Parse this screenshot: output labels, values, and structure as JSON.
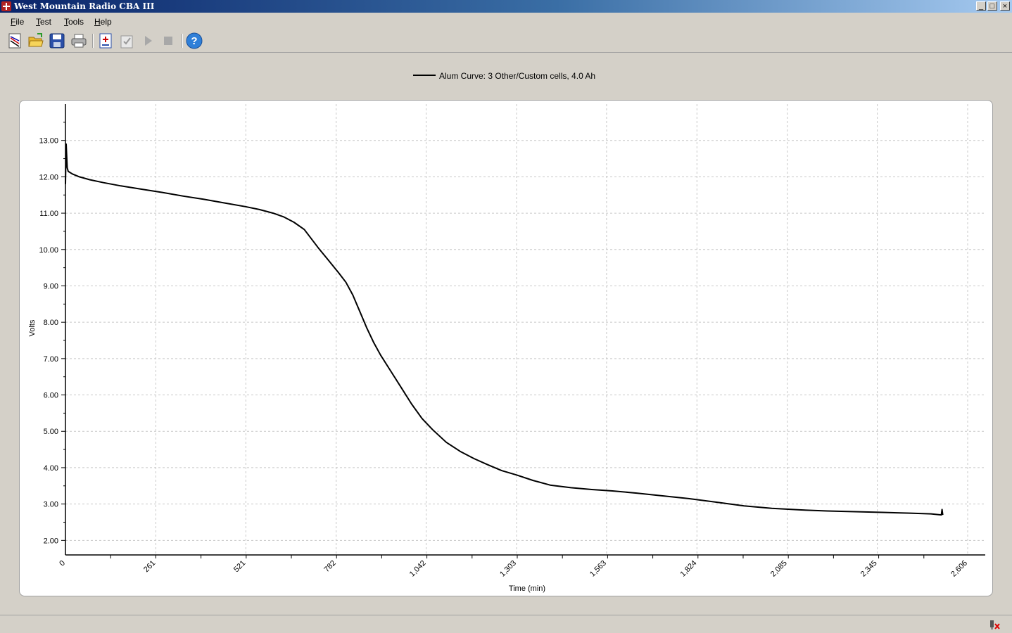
{
  "window": {
    "title": "West Mountain Radio CBA III",
    "controls": [
      "_",
      "□",
      "×"
    ]
  },
  "menu": {
    "items": [
      {
        "key": "F",
        "rest": "ile"
      },
      {
        "key": "T",
        "rest": "est"
      },
      {
        "key": "T",
        "rest": "ools"
      },
      {
        "key": "H",
        "rest": "elp"
      }
    ]
  },
  "toolbar": {
    "icons": [
      "new-graph-icon",
      "open-folder-icon",
      "save-icon",
      "print-icon",
      "add-test-icon",
      "checklist-icon",
      "play-icon",
      "stop-icon",
      "help-icon"
    ]
  },
  "colors": {
    "series": "#000000",
    "grid": "#c8c8c8",
    "window_bg": "#d4d0c8",
    "title_bar": "#0a246a"
  },
  "chart_data": {
    "type": "line",
    "series": [
      {
        "name": "Alum Curve: 3 Other/Custom cells, 4.0 Ah",
        "x": [
          0,
          2,
          5,
          8,
          20,
          40,
          70,
          110,
          160,
          220,
          280,
          340,
          400,
          460,
          520,
          560,
          600,
          630,
          660,
          690,
          710,
          730,
          760,
          790,
          810,
          830,
          850,
          870,
          890,
          910,
          940,
          970,
          1000,
          1030,
          1060,
          1100,
          1140,
          1180,
          1220,
          1260,
          1303,
          1350,
          1400,
          1460,
          1520,
          1580,
          1650,
          1720,
          1800,
          1880,
          1960,
          2040,
          2120,
          2200,
          2280,
          2360,
          2440,
          2500,
          2530,
          2532,
          2534
        ],
        "y": [
          11.8,
          12.9,
          12.25,
          12.15,
          12.08,
          12.0,
          11.92,
          11.84,
          11.75,
          11.66,
          11.57,
          11.47,
          11.38,
          11.28,
          11.18,
          11.1,
          11.0,
          10.9,
          10.75,
          10.55,
          10.3,
          10.05,
          9.7,
          9.35,
          9.1,
          8.75,
          8.3,
          7.85,
          7.45,
          7.1,
          6.65,
          6.2,
          5.75,
          5.35,
          5.05,
          4.7,
          4.45,
          4.25,
          4.08,
          3.92,
          3.8,
          3.65,
          3.52,
          3.45,
          3.4,
          3.36,
          3.3,
          3.23,
          3.15,
          3.05,
          2.95,
          2.88,
          2.84,
          2.81,
          2.79,
          2.77,
          2.75,
          2.73,
          2.7,
          2.85,
          2.7
        ]
      }
    ],
    "xlabel": "Time (min)",
    "ylabel": "Volts",
    "xlim": [
      0,
      2606
    ],
    "ylim": [
      1.6,
      14.0
    ],
    "xticks": [
      0,
      261,
      521,
      782,
      1042,
      1303,
      1563,
      1824,
      2085,
      2345,
      2606
    ],
    "xtick_labels": [
      "0",
      "261",
      "521",
      "782",
      "1,042",
      "1,303",
      "1,563",
      "1,824",
      "2,085",
      "2,345",
      "2,606"
    ],
    "yticks": [
      2,
      3,
      4,
      5,
      6,
      7,
      8,
      9,
      10,
      11,
      12,
      13
    ],
    "ytick_labels": [
      "2.00",
      "3.00",
      "4.00",
      "5.00",
      "6.00",
      "7.00",
      "8.00",
      "9.00",
      "10.00",
      "11.00",
      "12.00",
      "13.00"
    ],
    "grid": true,
    "legend_position": "top-center"
  }
}
